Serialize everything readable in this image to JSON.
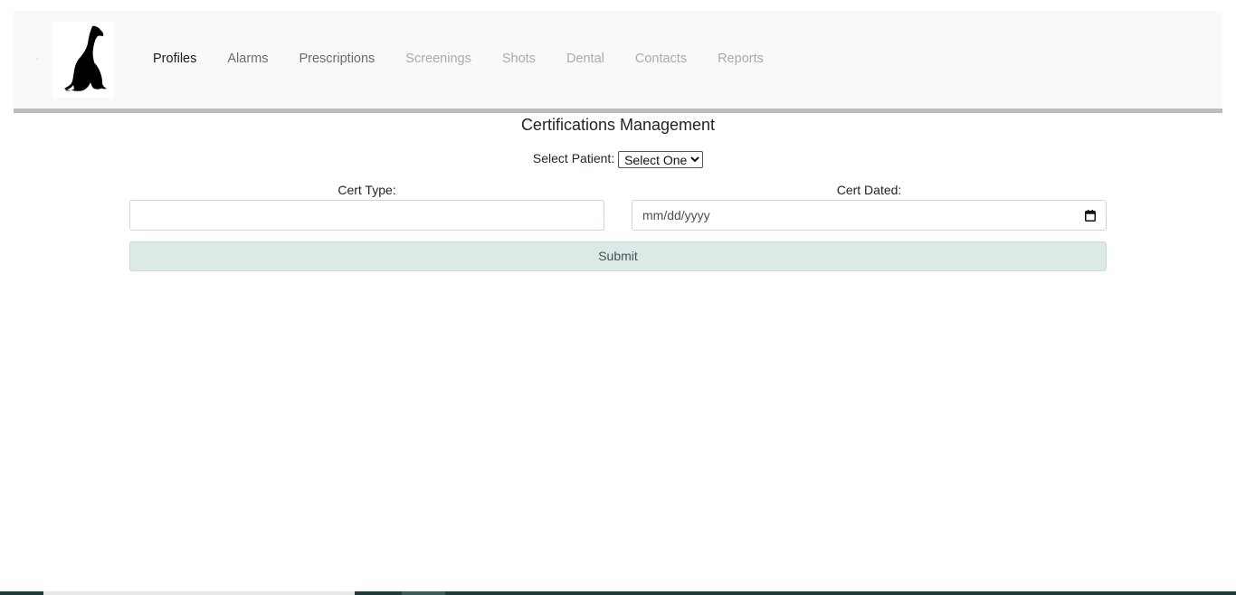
{
  "navbar": {
    "logo_icon": "greyhound-dog-logo",
    "items": [
      {
        "label": "Profiles",
        "state": "active"
      },
      {
        "label": "Alarms",
        "state": "normal"
      },
      {
        "label": "Prescriptions",
        "state": "normal"
      },
      {
        "label": "Screenings",
        "state": "muted"
      },
      {
        "label": "Shots",
        "state": "muted"
      },
      {
        "label": "Dental",
        "state": "muted"
      },
      {
        "label": "Contacts",
        "state": "muted"
      },
      {
        "label": "Reports",
        "state": "muted"
      }
    ]
  },
  "page": {
    "title": "Certifications Management"
  },
  "patient_select": {
    "label": "Select Patient:",
    "selected": "Select One"
  },
  "form": {
    "cert_type_label": "Cert Type:",
    "cert_type_value": "",
    "cert_dated_label": "Cert Dated:",
    "cert_dated_placeholder": "mm/dd/yyyy",
    "calendar_icon": "calendar-icon",
    "submit_label": "Submit"
  },
  "colors": {
    "navbar_bg": "#f8f9fa",
    "nav_rule": "#bdbdbd",
    "submit_bg": "#dbeae6",
    "taskbar": "#1f3a3a"
  }
}
